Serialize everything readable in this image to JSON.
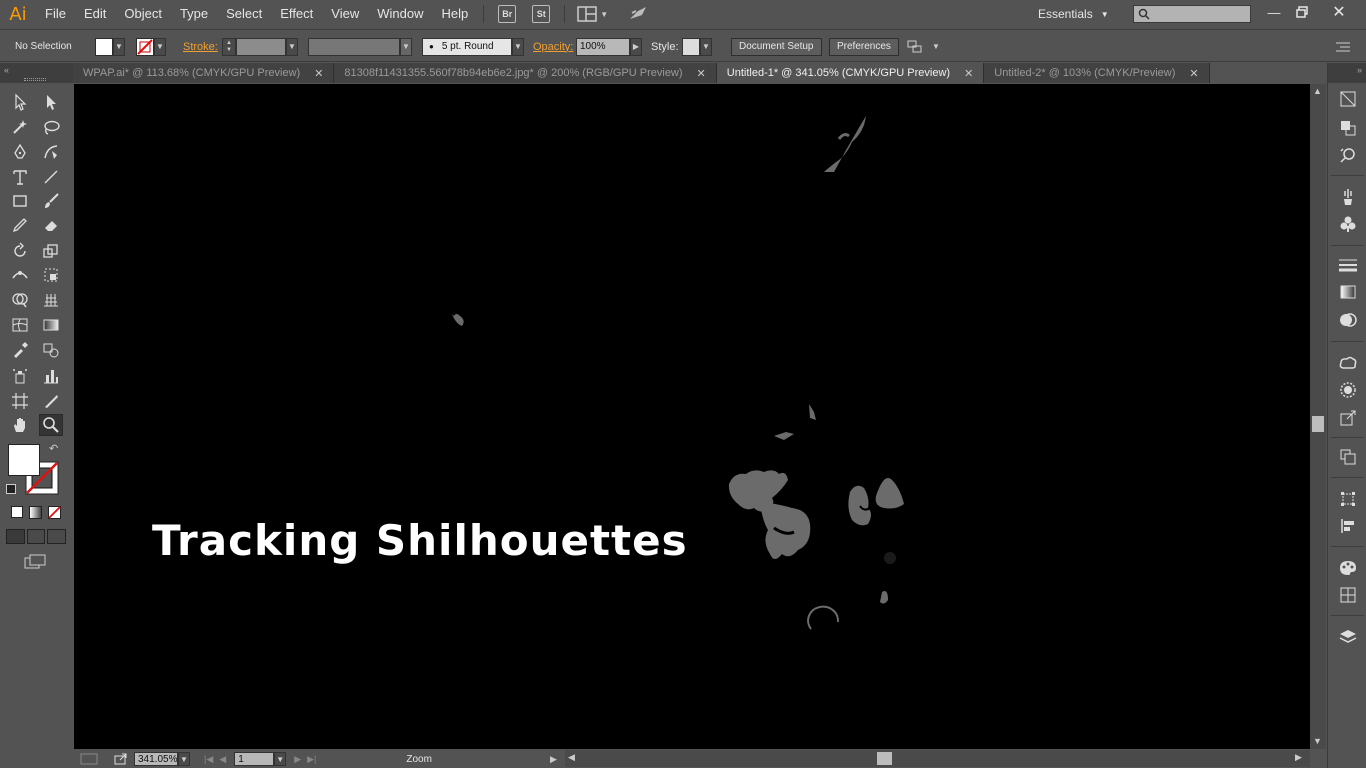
{
  "app": {
    "logo": "Ai"
  },
  "menu": [
    "File",
    "Edit",
    "Object",
    "Type",
    "Select",
    "Effect",
    "View",
    "Window",
    "Help"
  ],
  "menubar_icons": [
    {
      "name": "bridge",
      "label": "Br"
    },
    {
      "name": "stock",
      "label": "St"
    }
  ],
  "workspace": "Essentials",
  "search": {
    "placeholder": ""
  },
  "control_bar": {
    "selection": "No Selection",
    "stroke_label": "Stroke:",
    "brush": "5 pt. Round",
    "opacity_label": "Opacity:",
    "opacity_value": "100%",
    "style_label": "Style:",
    "document_setup": "Document Setup",
    "preferences": "Preferences"
  },
  "tabs": [
    {
      "label": "WPAP.ai* @ 113.68% (CMYK/GPU Preview)",
      "active": false
    },
    {
      "label": "81308f11431355.560f78b94eb6e2.jpg* @ 200% (RGB/GPU Preview)",
      "active": false
    },
    {
      "label": "Untitled-1* @ 341.05% (CMYK/GPU Preview)",
      "active": true
    },
    {
      "label": "Untitled-2* @ 103% (CMYK/Preview)",
      "active": false
    }
  ],
  "canvas": {
    "overlay_text": "Tracking Shilhouettes",
    "background": "#000000",
    "shape_color": "#6b6b6b"
  },
  "status": {
    "zoom": "341.05%",
    "artboard": "1",
    "tool": "Zoom"
  },
  "tools": [
    "selection-tool",
    "direct-selection-tool",
    "magic-wand-tool",
    "lasso-tool",
    "pen-tool",
    "curvature-tool",
    "type-tool",
    "line-segment-tool",
    "rectangle-tool",
    "paintbrush-tool",
    "pencil-tool",
    "eraser-tool",
    "rotate-tool",
    "scale-tool",
    "width-tool",
    "free-transform-tool",
    "shape-builder-tool",
    "perspective-grid-tool",
    "mesh-tool",
    "gradient-tool",
    "eyedropper-tool",
    "blend-tool",
    "symbol-sprayer-tool",
    "column-graph-tool",
    "artboard-tool",
    "slice-tool",
    "hand-tool",
    "zoom-tool"
  ],
  "colors": {
    "ui_bg": "#535353",
    "accent_orange": "#ff9a00",
    "canvas": "#000000"
  }
}
